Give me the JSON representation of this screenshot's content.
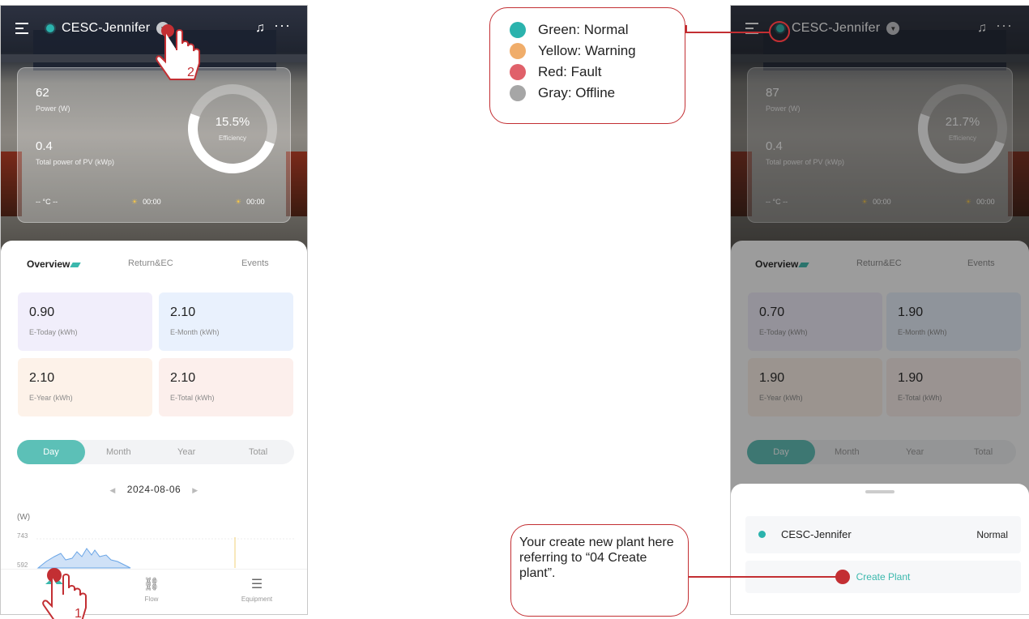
{
  "legend": {
    "items": [
      {
        "label": "Green: Normal",
        "color": "#2bb3ad"
      },
      {
        "label": "Yellow: Warning",
        "color": "#f0ad6a"
      },
      {
        "label": "Red: Fault",
        "color": "#e0616a"
      },
      {
        "label": "Gray: Offline",
        "color": "#a6a6a6"
      }
    ]
  },
  "callout_text": "Your create new plant here referring to “04 Create plant”.",
  "step_numbers": [
    "2",
    "1"
  ],
  "colors": {
    "accent": "#3bb8ad",
    "callout": "#c32f33",
    "status_normal": "#2bb3ad"
  },
  "screen1": {
    "plant_name": "CESC-Jennifer",
    "power_value": "62",
    "power_label": "Power (W)",
    "pv_value": "0.4",
    "pv_label": "Total power of PV (kWp)",
    "efficiency_value": "15.5%",
    "efficiency_label": "Efficiency",
    "temperature": "-- °C --",
    "sunrise": "00:00",
    "sunset": "00:00",
    "tabs": [
      "Overview",
      "Return&EC",
      "Events"
    ],
    "stats": [
      {
        "value": "0.90",
        "label": "E-Today (kWh)"
      },
      {
        "value": "2.10",
        "label": "E-Month (kWh)"
      },
      {
        "value": "2.10",
        "label": "E-Year (kWh)"
      },
      {
        "value": "2.10",
        "label": "E-Total (kWh)"
      }
    ],
    "periods": [
      "Day",
      "Month",
      "Year",
      "Total"
    ],
    "date": "2024-08-06",
    "chart_unit": "(W)",
    "chart_ticks": [
      "743",
      "592"
    ],
    "nav": {
      "flow": "Flow",
      "equipment": "Equipment"
    }
  },
  "screen2": {
    "plant_name": "CESC-Jennifer",
    "power_value": "87",
    "power_label": "Power (W)",
    "pv_value": "0.4",
    "pv_label": "Total power of PV (kWp)",
    "efficiency_value": "21.7%",
    "efficiency_label": "Efficiency",
    "temperature": "-- °C --",
    "sunrise": "00:00",
    "sunset": "00:00",
    "tabs": [
      "Overview",
      "Return&EC",
      "Events"
    ],
    "stats": [
      {
        "value": "0.70",
        "label": "E-Today (kWh)"
      },
      {
        "value": "1.90",
        "label": "E-Month (kWh)"
      },
      {
        "value": "1.90",
        "label": "E-Year (kWh)"
      },
      {
        "value": "1.90",
        "label": "E-Total (kWh)"
      }
    ],
    "periods": [
      "Day",
      "Month",
      "Year",
      "Total"
    ],
    "sheet": {
      "plant_name": "CESC-Jennifer",
      "plant_status": "Normal",
      "create_label": "Create Plant"
    }
  }
}
